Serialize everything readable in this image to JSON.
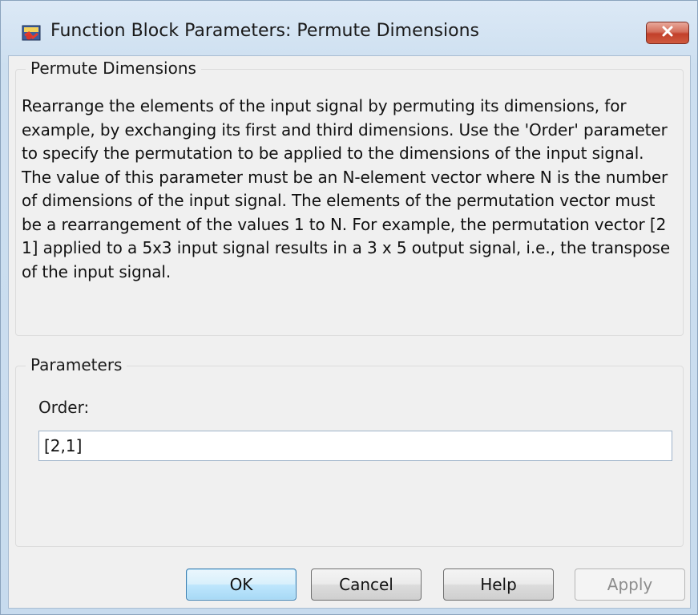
{
  "window": {
    "title": "Function Block Parameters: Permute Dimensions",
    "close_icon": "close-icon",
    "app_icon": "simulink-block-icon"
  },
  "block_group": {
    "title": "Permute Dimensions",
    "description": "Rearrange the elements of the input signal by permuting its dimensions, for example, by exchanging its first and third dimensions. Use the 'Order' parameter to specify the permutation to be applied to the dimensions of the input signal. The value of this parameter must be an N-element vector where N is the number of dimensions of the input signal. The elements of the permutation vector must be a rearrangement of the values 1 to N. For example, the permutation vector [2 1] applied to a 5x3 input signal results in a 3 x 5 output signal, i.e., the transpose of the input signal."
  },
  "parameters_group": {
    "title": "Parameters",
    "order_label": "Order:",
    "order_value": "[2,1]"
  },
  "buttons": {
    "ok": "OK",
    "cancel": "Cancel",
    "help": "Help",
    "apply": "Apply"
  },
  "colors": {
    "close_button": "#c7432c",
    "default_button_border": "#3c7fb1",
    "dialog_background": "#f0f0f0"
  }
}
